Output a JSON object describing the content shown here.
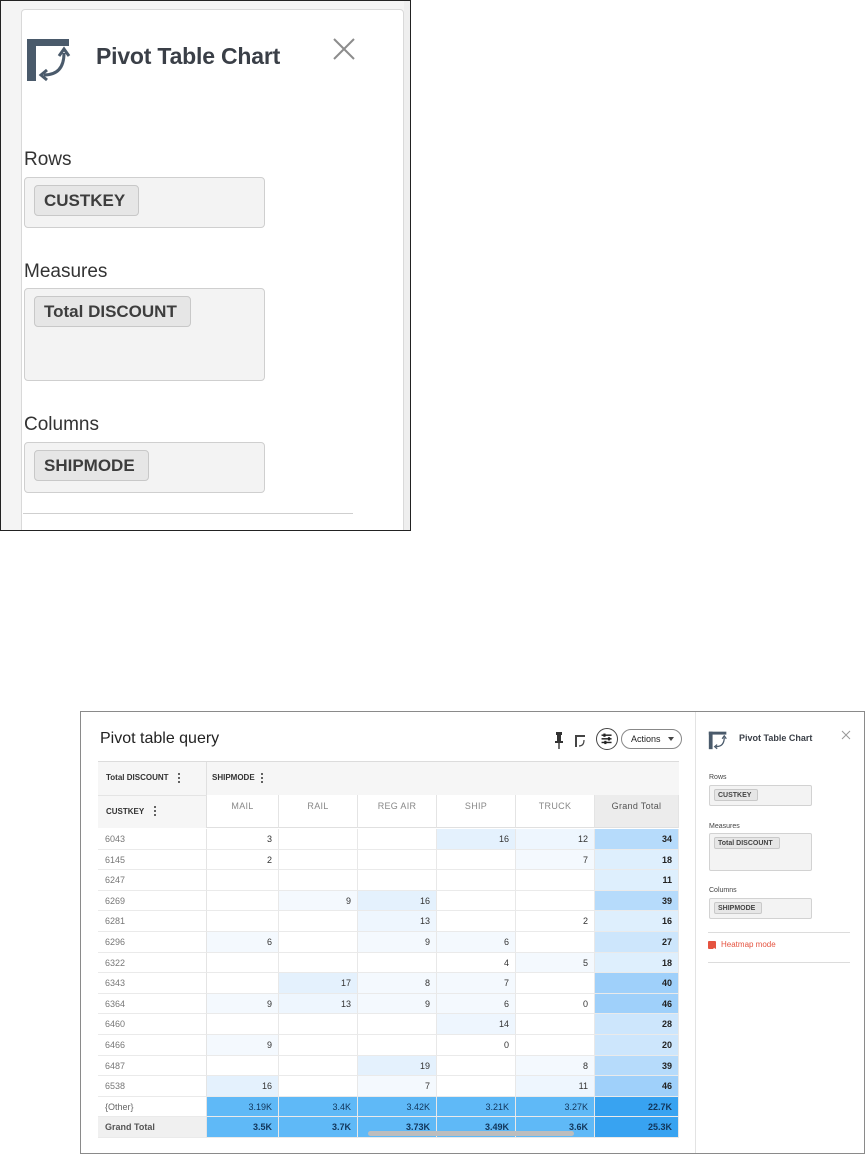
{
  "zoom_panel": {
    "title": "Pivot Table Chart",
    "rows_label": "Rows",
    "rows_chip": "CUSTKEY",
    "measures_label": "Measures",
    "measures_chip": "Total DISCOUNT",
    "columns_label": "Columns",
    "columns_chip": "SHIPMODE"
  },
  "app": {
    "query_title": "Pivot table query",
    "actions_label": "Actions",
    "grid": {
      "measure_header": "Total DISCOUNT",
      "row_dim_header": "CUSTKEY",
      "col_dim_header": "SHIPMODE",
      "columns": [
        "MAIL",
        "RAIL",
        "REG AIR",
        "SHIP",
        "TRUCK",
        "Grand Total"
      ],
      "rows": [
        {
          "key": "6043",
          "cells": [
            "3",
            "",
            "",
            "16",
            "12",
            "34"
          ]
        },
        {
          "key": "6145",
          "cells": [
            "2",
            "",
            "",
            "",
            "7",
            "18"
          ]
        },
        {
          "key": "6247",
          "cells": [
            "",
            "",
            "",
            "",
            "",
            "11"
          ]
        },
        {
          "key": "6269",
          "cells": [
            "",
            "9",
            "16",
            "",
            "",
            "39"
          ]
        },
        {
          "key": "6281",
          "cells": [
            "",
            "",
            "13",
            "",
            "2",
            "16"
          ]
        },
        {
          "key": "6296",
          "cells": [
            "6",
            "",
            "9",
            "6",
            "",
            "27"
          ]
        },
        {
          "key": "6322",
          "cells": [
            "",
            "",
            "",
            "4",
            "5",
            "18"
          ]
        },
        {
          "key": "6343",
          "cells": [
            "",
            "17",
            "8",
            "7",
            "",
            "40"
          ]
        },
        {
          "key": "6364",
          "cells": [
            "9",
            "13",
            "9",
            "6",
            "0",
            "46"
          ]
        },
        {
          "key": "6460",
          "cells": [
            "",
            "",
            "",
            "14",
            "",
            "28"
          ]
        },
        {
          "key": "6466",
          "cells": [
            "9",
            "",
            "",
            "0",
            "",
            "20"
          ]
        },
        {
          "key": "6487",
          "cells": [
            "",
            "",
            "19",
            "",
            "8",
            "39"
          ]
        },
        {
          "key": "6538",
          "cells": [
            "16",
            "",
            "7",
            "",
            "11",
            "46"
          ]
        },
        {
          "key": "{Other}",
          "cells": [
            "3.19K",
            "3.4K",
            "3.42K",
            "3.21K",
            "3.27K",
            "22.7K"
          ]
        },
        {
          "key": "Grand Total",
          "cells": [
            "3.5K",
            "3.7K",
            "3.73K",
            "3.49K",
            "3.6K",
            "25.3K"
          ]
        }
      ]
    }
  },
  "side_panel": {
    "title": "Pivot Table Chart",
    "rows_label": "Rows",
    "rows_chip": "CUSTKEY",
    "measures_label": "Measures",
    "measures_chip": "Total DISCOUNT",
    "columns_label": "Columns",
    "columns_chip": "SHIPMODE",
    "heatmap_label": "Heatmap mode",
    "heatmap_checked": true
  },
  "colors": {
    "heat_light": "#eef6fe",
    "heat_mid": "#b9dcfb",
    "heat_strong": "#5fb9f7",
    "heat_max": "#38a3f1",
    "accent_red": "#e55340"
  },
  "icons": [
    "pivot-chart-icon",
    "close-icon",
    "pin-icon",
    "chart-type-icon",
    "filter-settings-icon",
    "dropdown-caret-icon",
    "more-vertical-icon",
    "checkbox-icon"
  ]
}
